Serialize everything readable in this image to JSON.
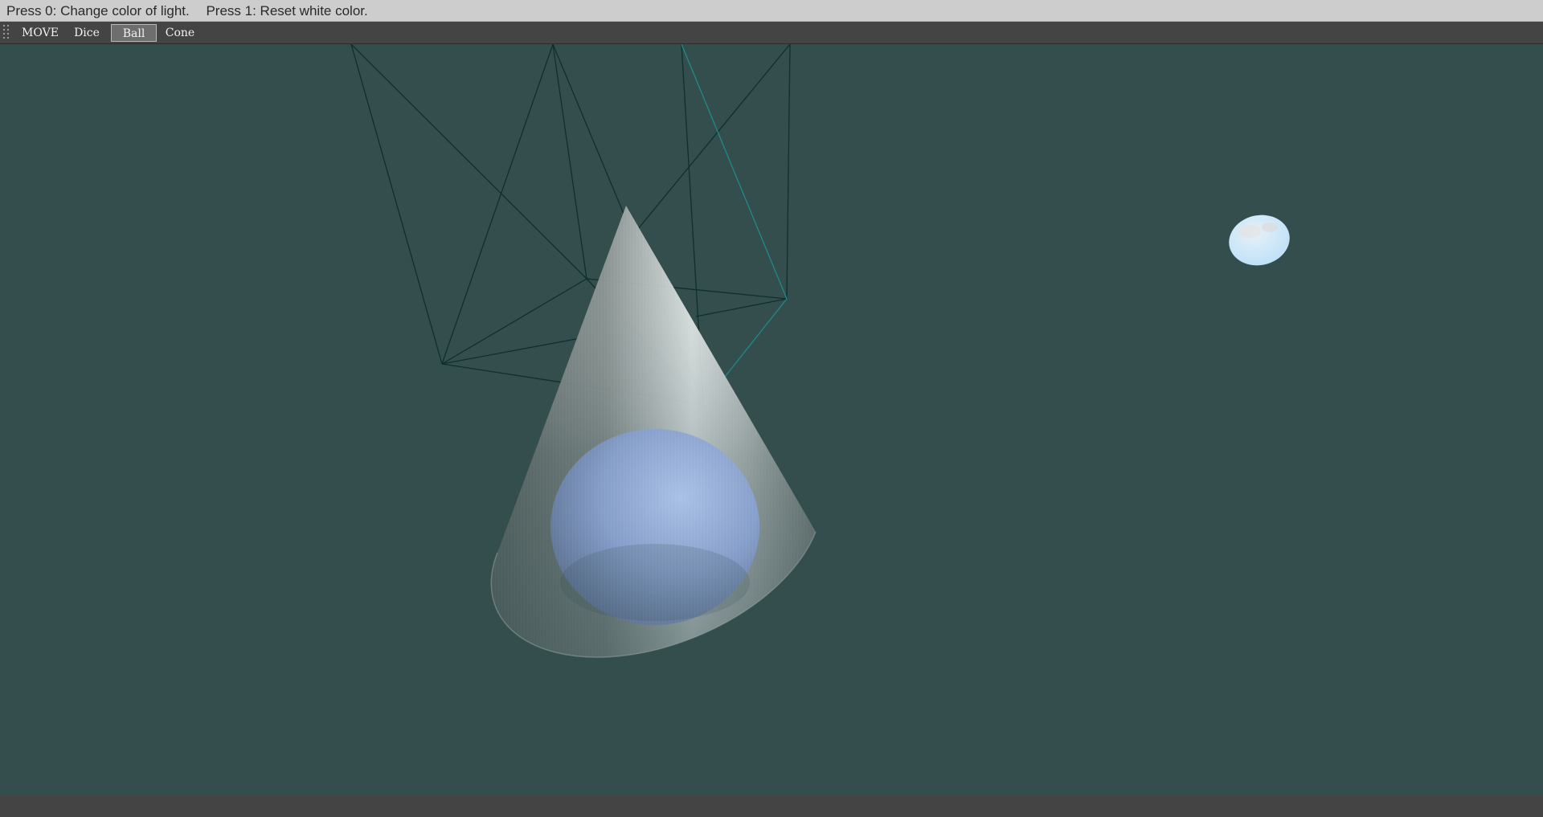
{
  "window": {
    "hint_0": "Press 0: Change color of light.",
    "hint_1": "Press 1: Reset white color."
  },
  "toolbar": {
    "items": [
      {
        "label": "MOVE",
        "active": false
      },
      {
        "label": "Dice",
        "active": false
      },
      {
        "label": "Ball",
        "active": true
      },
      {
        "label": "Cone",
        "active": false
      }
    ]
  },
  "scene": {
    "background_color": "#344e4e",
    "objects": [
      {
        "name": "wireframe-dice",
        "color": "#0f2e2e",
        "highlight_color": "#1f8a8a"
      },
      {
        "name": "cone",
        "color": "#d8d8d8"
      },
      {
        "name": "ball",
        "color": "#8fa9d6"
      },
      {
        "name": "moon-light",
        "color": "#cfe6f7"
      }
    ]
  }
}
